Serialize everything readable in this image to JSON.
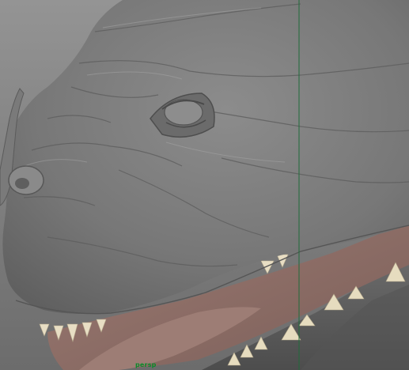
{
  "viewport": {
    "camera_label": "persp",
    "colors": {
      "background_top": "#8f8f8f",
      "background_bottom": "#6e6e6e",
      "model_skin": "#7b7b7b",
      "model_highlight": "#9a9a9a",
      "mouth_interior": "#8a6a64",
      "teeth": "#e6dcc0",
      "axis_line": "#1f6b3a"
    }
  }
}
